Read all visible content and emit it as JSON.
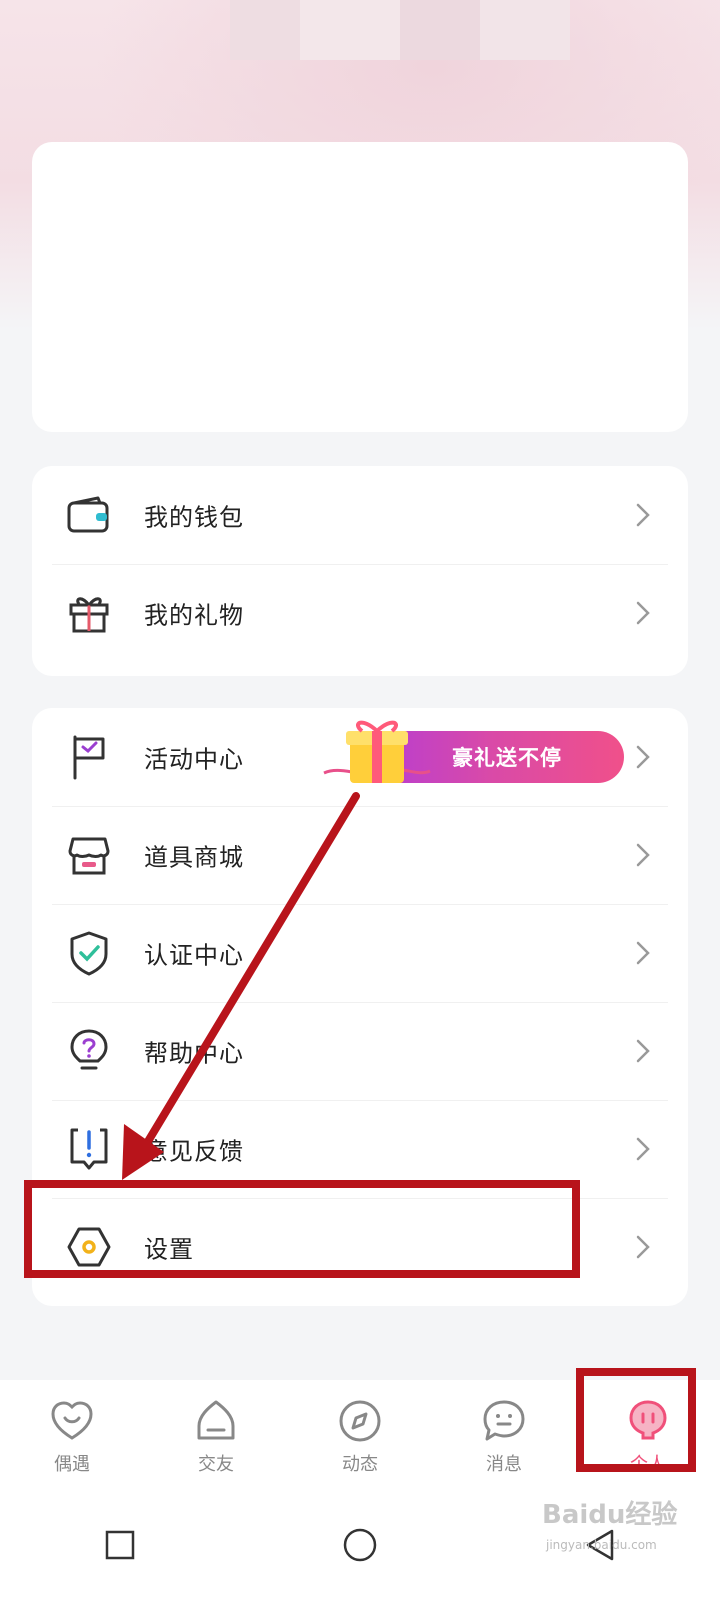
{
  "menu_group_1": [
    {
      "label": "我的钱包",
      "icon": "wallet-icon"
    },
    {
      "label": "我的礼物",
      "icon": "gift-box-icon"
    }
  ],
  "menu_group_2": [
    {
      "label": "活动中心",
      "icon": "flag-icon",
      "promo": "豪礼送不停"
    },
    {
      "label": "道具商城",
      "icon": "shop-icon"
    },
    {
      "label": "认证中心",
      "icon": "shield-check-icon"
    },
    {
      "label": "帮助中心",
      "icon": "help-bulb-icon"
    },
    {
      "label": "意见反馈",
      "icon": "feedback-icon"
    },
    {
      "label": "设置",
      "icon": "settings-hexagon-icon"
    }
  ],
  "tabbar": [
    {
      "label": "偶遇",
      "icon": "heart-smile-icon",
      "active": false
    },
    {
      "label": "交友",
      "icon": "home-smile-icon",
      "active": false
    },
    {
      "label": "动态",
      "icon": "compass-icon",
      "active": false
    },
    {
      "label": "消息",
      "icon": "chat-face-icon",
      "active": false
    },
    {
      "label": "个人",
      "icon": "profile-icon",
      "active": true
    }
  ],
  "system_nav": [
    "square-icon",
    "circle-icon",
    "back-triangle-icon"
  ],
  "watermark": {
    "brand": "Baidu经验",
    "url": "jingyan.baidu.com"
  },
  "colors": {
    "accent": "#f0507a",
    "annotation": "#b8141b",
    "check": "#2fbf9a",
    "settings_ring": "#f2b21a"
  }
}
